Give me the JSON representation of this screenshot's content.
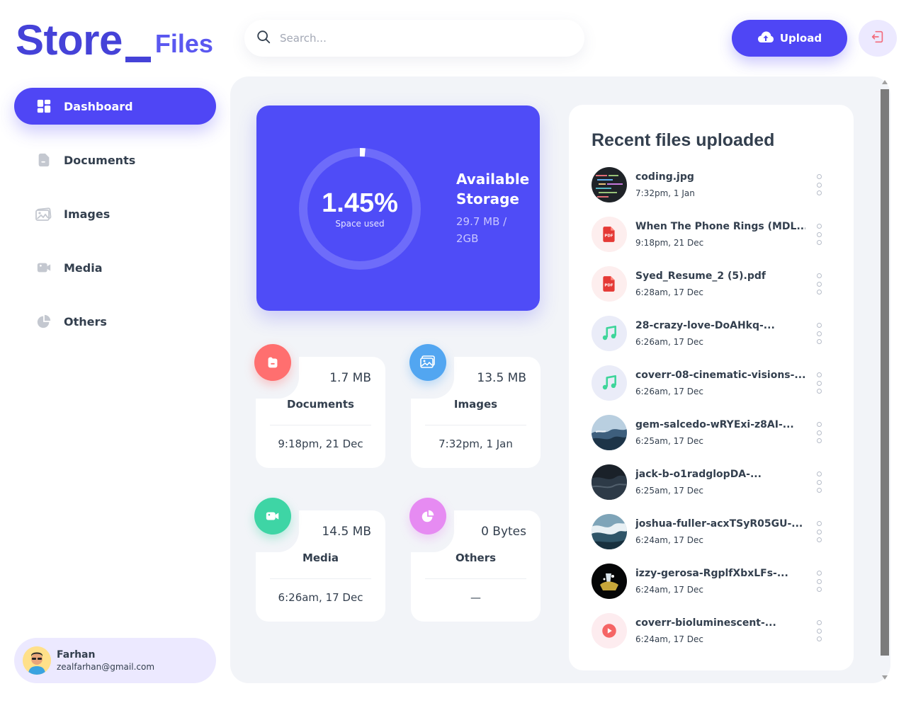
{
  "app": {
    "logo_main": "Store",
    "logo_sub": "Files"
  },
  "search": {
    "placeholder": "Search..."
  },
  "header": {
    "upload_label": "Upload"
  },
  "nav": [
    {
      "label": "Dashboard",
      "icon": "dashboard-icon",
      "active": true
    },
    {
      "label": "Documents",
      "icon": "document-icon"
    },
    {
      "label": "Images",
      "icon": "images-icon"
    },
    {
      "label": "Media",
      "icon": "video-icon"
    },
    {
      "label": "Others",
      "icon": "pie-icon"
    }
  ],
  "user": {
    "name": "Farhan",
    "email": "zealfarhan@gmail.com"
  },
  "storage": {
    "percent_label": "1.45%",
    "percent_value": 1.45,
    "space_label": "Space used",
    "title": "Available Storage",
    "amount": "29.7 MB / 2GB"
  },
  "summary": [
    {
      "title": "Documents",
      "size": "1.7 MB",
      "date": "9:18pm, 21 Dec",
      "color": "#ff6f6f"
    },
    {
      "title": "Images",
      "size": "13.5 MB",
      "date": "7:32pm, 1 Jan",
      "color": "#52a6f1"
    },
    {
      "title": "Media",
      "size": "14.5 MB",
      "date": "6:26am, 17 Dec",
      "color": "#3ed5a5"
    },
    {
      "title": "Others",
      "size": "0 Bytes",
      "date": "—",
      "color": "#e68bf2"
    }
  ],
  "recent": {
    "title": "Recent files uploaded",
    "files": [
      {
        "name": "coding.jpg",
        "time": "7:32pm, 1 Jan",
        "type": "image"
      },
      {
        "name": "When The Phone Rings (MDL...",
        "time": "9:18pm, 21 Dec",
        "type": "pdf"
      },
      {
        "name": "Syed_Resume_2 (5).pdf",
        "time": "6:28am, 17 Dec",
        "type": "pdf"
      },
      {
        "name": "28-crazy-love-DoAHkq-...",
        "time": "6:26am, 17 Dec",
        "type": "audio"
      },
      {
        "name": "coverr-08-cinematic-visions-...",
        "time": "6:26am, 17 Dec",
        "type": "audio"
      },
      {
        "name": "gem-salcedo-wRYExi-z8AI-...",
        "time": "6:25am, 17 Dec",
        "type": "image"
      },
      {
        "name": "jack-b-o1radglopDA-...",
        "time": "6:25am, 17 Dec",
        "type": "image"
      },
      {
        "name": "joshua-fuller-acxTSyR05GU-...",
        "time": "6:24am, 17 Dec",
        "type": "image"
      },
      {
        "name": "izzy-gerosa-RgplfXbxLFs-...",
        "time": "6:24am, 17 Dec",
        "type": "image"
      },
      {
        "name": "coverr-bioluminescent-...",
        "time": "6:24am, 17 Dec",
        "type": "video"
      }
    ]
  },
  "colors": {
    "primary": "#4f46f5",
    "panel": "#f2f4f8",
    "text": "#333f4e"
  }
}
